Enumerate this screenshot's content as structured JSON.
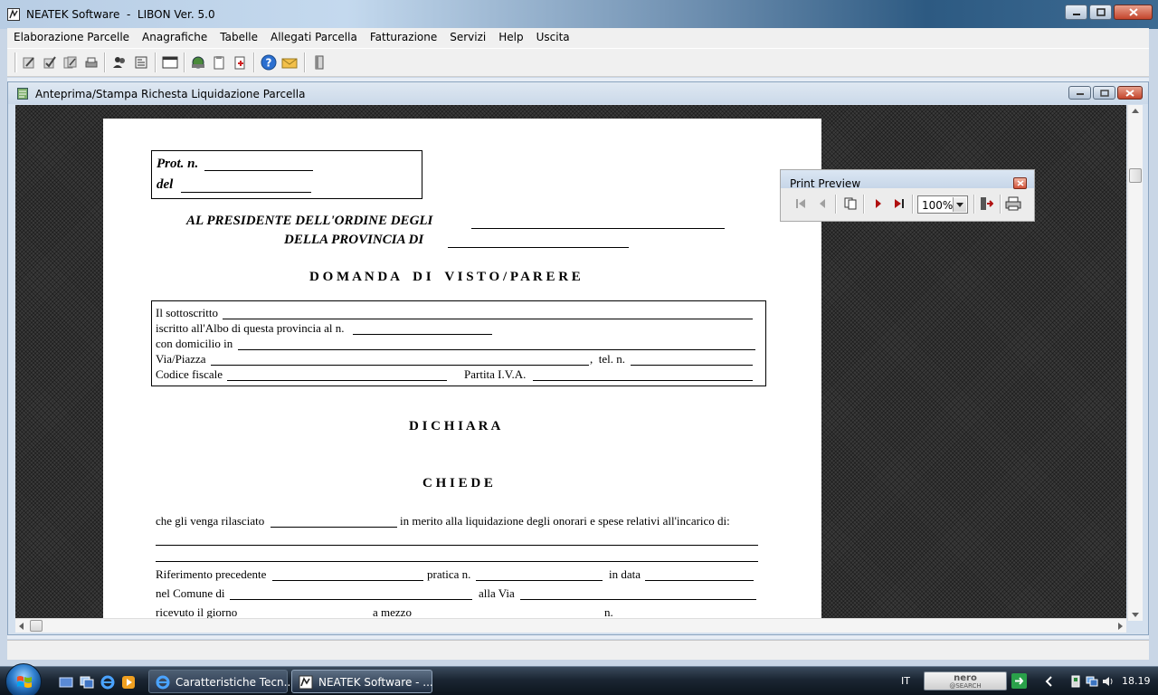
{
  "window": {
    "title": "NEATEK Software  -  LIBON Ver. 5.0"
  },
  "menu": [
    "Elaborazione Parcelle",
    "Anagrafiche",
    "Tabelle",
    "Allegati Parcella",
    "Fatturazione",
    "Servizi",
    "Help",
    "Uscita"
  ],
  "toolbar": {
    "icons": [
      "edit-icon",
      "check-edit-icon",
      "batch-edit-icon",
      "printer-stack-icon",
      "users-icon",
      "calculator-icon",
      "window-icon",
      "money-icon",
      "clipboard-icon",
      "document-remove-icon",
      "help-icon",
      "envelope-icon",
      "exit-door-icon"
    ]
  },
  "child_window": {
    "title": "Anteprima/Stampa Richesta Liquidazione Parcella"
  },
  "print_preview": {
    "title": "Print Preview",
    "zoom": "100%"
  },
  "document": {
    "prot_label": "Prot. n.",
    "del_label": "del",
    "addressee_line1": "AL  PRESIDENTE  DELL'ORDINE  DEGLI",
    "addressee_line2": "DELLA  PROVINCIA  DI",
    "heading_domanda": "D O M A N D A    D I    V I S T O / P A R E R E",
    "field_sottoscritto": "Il sottoscritto",
    "field_iscritto": "iscritto all'Albo di questa provincia al n.",
    "field_domicilio": "con domicilio in",
    "field_via": "Via/Piazza",
    "field_tel": ",  tel. n.",
    "field_codice_fiscale": "Codice fiscale",
    "field_partita_iva": "Partita I.V.A.",
    "heading_dichiara": "D I C H I A R A",
    "heading_chiede": "C H I E D E",
    "request_prefix": "che gli venga rilasciato",
    "request_suffix": "in merito alla liquidazione degli onorari e spese relativi all'incarico di:",
    "riferimento": "Riferimento precedente",
    "pratica": "pratica n.",
    "in_data": "in data",
    "nel_comune": "nel Comune di",
    "alla_via": "alla Via",
    "ricevuto": "ricevuto il giorno",
    "a_mezzo": "a mezzo",
    "n_label": "n."
  },
  "taskbar": {
    "buttons": [
      {
        "label": "Caratteristiche Tecn...",
        "icon": "ie-icon",
        "active": false
      },
      {
        "label": "NEATEK Software - ...",
        "icon": "app-icon",
        "active": true
      }
    ],
    "language": "IT",
    "search_brand_top": "nero",
    "search_brand_bottom": "@SEARCH",
    "clock": "18.19"
  },
  "colors": {
    "titlebar_accent": "#2d5a82",
    "close_red": "#c4452c",
    "preview_background": "#3b3b3b",
    "taskbar": "#1b2633"
  }
}
